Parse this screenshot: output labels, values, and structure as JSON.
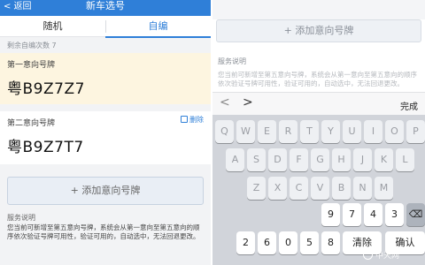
{
  "left": {
    "nav": {
      "back": "< 返回",
      "title": "新车选号"
    },
    "tabs": [
      {
        "label": "随机"
      },
      {
        "label": "自编"
      }
    ],
    "remaining": "剩余自编次数 7",
    "cards": [
      {
        "label": "第一意向号牌",
        "plate": "粤B9Z7Z7"
      },
      {
        "label": "第二意向号牌",
        "plate": "粤B9Z7T7",
        "delete": "删除"
      }
    ],
    "add_button": "+ 添加意向号牌",
    "service_title": "服务说明",
    "service_text": "您当前可新增至第五意向号牌，系统会从第一意向至第五意向的顺序依次验证号牌可用性，验证可用的，自动选中，无法回退更改。"
  },
  "right": {
    "add_button": "+ 添加意向号牌",
    "service_title": "服务说明",
    "service_text": "您当前可新增至第五意向号牌，系统会从第一意向至第五意向的顺序依次验证号牌可用性，验证可用的，自动选中，无法回退更改。",
    "toolbar": {
      "prev": "<",
      "next": ">",
      "done": "完成"
    },
    "keyboard": {
      "row1": [
        "Q",
        "W",
        "E",
        "R",
        "T",
        "Y",
        "U",
        "I",
        "O",
        "P"
      ],
      "row2": [
        "A",
        "S",
        "D",
        "F",
        "G",
        "H",
        "J",
        "K",
        "L"
      ],
      "row3": [
        "Z",
        "X",
        "C",
        "V",
        "B",
        "N",
        "M"
      ],
      "row4": [
        "9",
        "7",
        "4",
        "3"
      ],
      "row5": [
        "2",
        "6",
        "0",
        "5",
        "8",
        "清除",
        "确认"
      ],
      "backspace": "⌫"
    }
  },
  "watermark": "中天网"
}
